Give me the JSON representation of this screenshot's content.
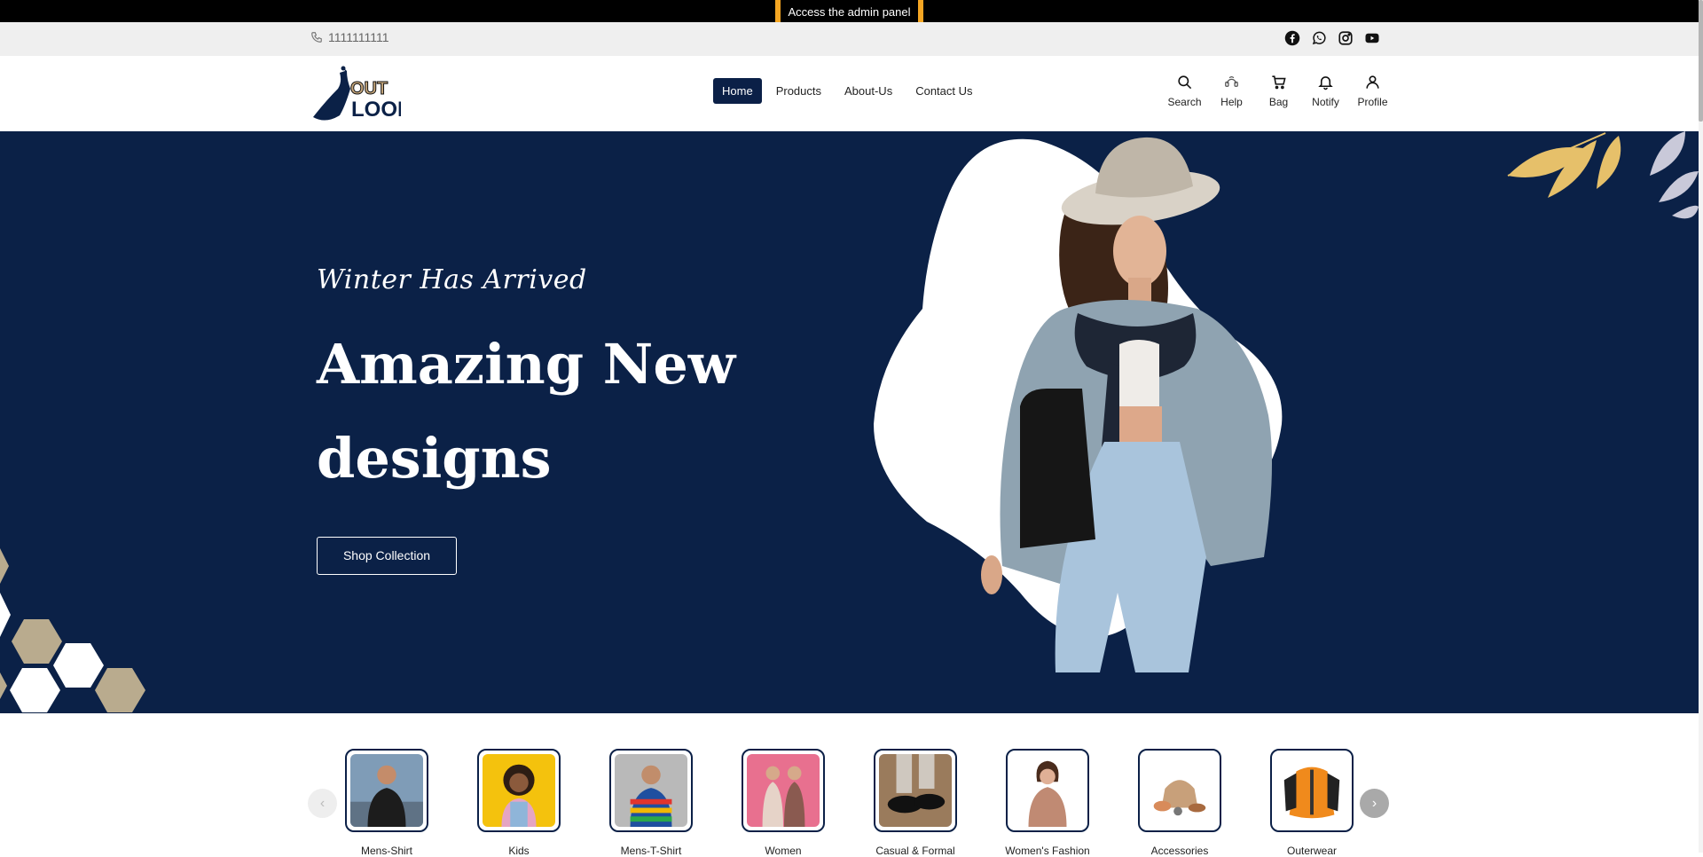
{
  "admin": {
    "link_label": "Access the admin panel",
    "accent": "#f5a623"
  },
  "contact": {
    "phone_icon": "phone-icon",
    "phone": "1111111111",
    "socials": [
      "facebook-icon",
      "whatsapp-icon",
      "instagram-icon",
      "youtube-icon"
    ]
  },
  "brand": {
    "logo_top": "OUT",
    "logo_bottom": "LOOK",
    "primary": "#0b2147"
  },
  "nav": {
    "items": [
      {
        "label": "Home",
        "active": true
      },
      {
        "label": "Products",
        "active": false
      },
      {
        "label": "About-Us",
        "active": false
      },
      {
        "label": "Contact Us",
        "active": false
      }
    ]
  },
  "actions": {
    "items": [
      {
        "icon": "search-icon",
        "label": "Search"
      },
      {
        "icon": "help-icon",
        "label": "Help"
      },
      {
        "icon": "bag-icon",
        "label": "Bag"
      },
      {
        "icon": "bell-icon",
        "label": "Notify"
      },
      {
        "icon": "user-icon",
        "label": "Profile"
      }
    ]
  },
  "hero": {
    "tagline": "Winter Has Arrived",
    "title": "Amazing New designs",
    "cta": "Shop Collection"
  },
  "categories": {
    "items": [
      {
        "label": "Mens-Shirt"
      },
      {
        "label": "Kids"
      },
      {
        "label": "Mens-T-Shirt"
      },
      {
        "label": "Women"
      },
      {
        "label": "Casual & Formal"
      },
      {
        "label": "Women's Fashion"
      },
      {
        "label": "Accessories"
      },
      {
        "label": "Outerwear"
      }
    ],
    "prev_icon": "chevron-left-icon",
    "next_icon": "chevron-right-icon"
  }
}
